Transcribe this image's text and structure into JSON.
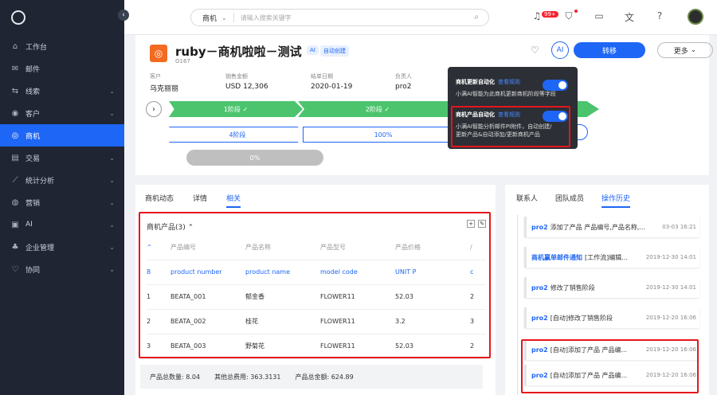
{
  "sidebar": {
    "items": [
      {
        "label": "工作台",
        "icon": "home-icon",
        "arrow": false
      },
      {
        "label": "邮件",
        "icon": "mail-icon",
        "arrow": false
      },
      {
        "label": "线索",
        "icon": "lead-icon",
        "arrow": true
      },
      {
        "label": "客户",
        "icon": "customer-icon",
        "arrow": true
      },
      {
        "label": "商机",
        "icon": "target-icon",
        "arrow": false,
        "active": true
      },
      {
        "label": "交易",
        "icon": "trade-icon",
        "arrow": true
      },
      {
        "label": "统计分析",
        "icon": "chart-icon",
        "arrow": true
      },
      {
        "label": "营销",
        "icon": "marketing-icon",
        "arrow": true
      },
      {
        "label": "AI",
        "icon": "ai-icon",
        "arrow": true
      },
      {
        "label": "企业管理",
        "icon": "org-icon",
        "arrow": true
      },
      {
        "label": "协同",
        "icon": "collab-icon",
        "arrow": true
      }
    ]
  },
  "topbar": {
    "search_category": "商机",
    "search_placeholder": "请输入搜索关键字",
    "notif_badge": "99+"
  },
  "header": {
    "title": "ruby－商机啦啦－测试",
    "tag_ai": "AI",
    "tag_auto": "自动创建",
    "sub_id": "O167",
    "ai_button": "AI",
    "transfer_button": "转移",
    "more_button": "更多",
    "fields": [
      {
        "key": "客户",
        "value": "乌克丽丽"
      },
      {
        "key": "销售金额",
        "value": "USD 12,306"
      },
      {
        "key": "结单日期",
        "value": "2020-01-19"
      },
      {
        "key": "负责人",
        "value": "pro2"
      }
    ]
  },
  "stages": {
    "row1": [
      "1阶段 ✓",
      "2阶段 ✓"
    ],
    "row2": [
      "4阶段",
      "100%"
    ],
    "row3": "0%"
  },
  "popup": {
    "item1_title": "商机更新自动化",
    "item1_link": "查看规则",
    "item1_desc": "小满AI智能为此商机更新商机阶段等字段",
    "item2_title": "商机产品自动化",
    "item2_link": "查看规则",
    "item2_desc1": "小满AI智能分析邮件PI附件，自动创建/",
    "item2_desc2": "更新产品&自动添加/更新商机产品"
  },
  "left_tabs": [
    "商机动态",
    "详情",
    "相关"
  ],
  "products": {
    "header": "商机产品(3)",
    "columns": [
      "产品编号",
      "产品名称",
      "产品型号",
      "产品价格",
      "/"
    ],
    "rows": [
      {
        "idx": "8",
        "no": "product number",
        "name": "product name",
        "model": "model code",
        "price": "UNIT P",
        "extra": "c"
      },
      {
        "idx": "1",
        "no": "BEATA_001",
        "name": "郁金香",
        "model": "FLOWER11",
        "price": "52.03",
        "extra": "2"
      },
      {
        "idx": "2",
        "no": "BEATA_002",
        "name": "桂花",
        "model": "FLOWER11",
        "price": "3.2",
        "extra": "3"
      },
      {
        "idx": "3",
        "no": "BEATA_003",
        "name": "野菊花",
        "model": "FLOWER11",
        "price": "52.03",
        "extra": "2"
      }
    ],
    "summary": [
      "产品总数量: 8.04",
      "其他总费用: 363.3131",
      "产品总金额: 624.89"
    ]
  },
  "right_tabs": [
    "联系人",
    "团队成员",
    "操作历史"
  ],
  "history": [
    {
      "user": "pro2",
      "text": "添加了产品 产品编号,产品名称,...",
      "time": "03-03 16:21"
    },
    {
      "user": "商机赢单邮件通知",
      "text": "[工作流]编辑...",
      "time": "2019-12-30 14:01"
    },
    {
      "user": "pro2",
      "text": "修改了销售阶段",
      "time": "2019-12-30 14:01"
    },
    {
      "user": "pro2",
      "text": "[自动]修改了销售阶段",
      "time": "2019-12-20 16:06"
    },
    {
      "user": "pro2",
      "text": "[自动]添加了产品 产品编...",
      "time": "2019-12-20 16:06"
    },
    {
      "user": "pro2",
      "text": "[自动]添加了产品 产品编...",
      "time": "2019-12-20 16:06"
    }
  ]
}
